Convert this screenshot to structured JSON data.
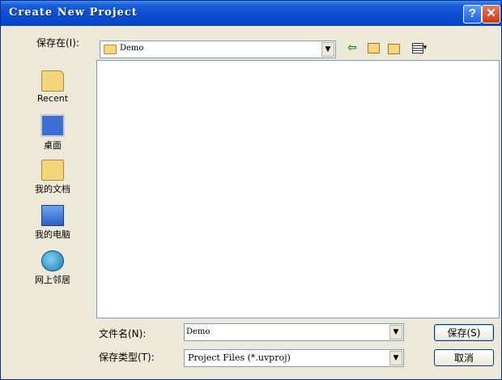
{
  "window": {
    "title": "Create New Project"
  },
  "lookin": {
    "label": "保存在(I):",
    "value": "Demo"
  },
  "places": [
    {
      "label": "Recent",
      "icon": "recent-folder-icon"
    },
    {
      "label": "桌面",
      "icon": "desktop-icon"
    },
    {
      "label": "我的文档",
      "icon": "my-documents-icon"
    },
    {
      "label": "我的电脑",
      "icon": "my-computer-icon"
    },
    {
      "label": "网上邻居",
      "icon": "network-icon"
    }
  ],
  "filename": {
    "label": "文件名(N):",
    "value": "Demo"
  },
  "filetype": {
    "label": "保存类型(T):",
    "value": "Project Files (*.uvproj)"
  },
  "buttons": {
    "save": "保存(S)",
    "cancel": "取消"
  },
  "colors": {
    "titlebar": "#0a4dd0",
    "dialog_bg": "#ece9d8",
    "close": "#c53a16"
  }
}
